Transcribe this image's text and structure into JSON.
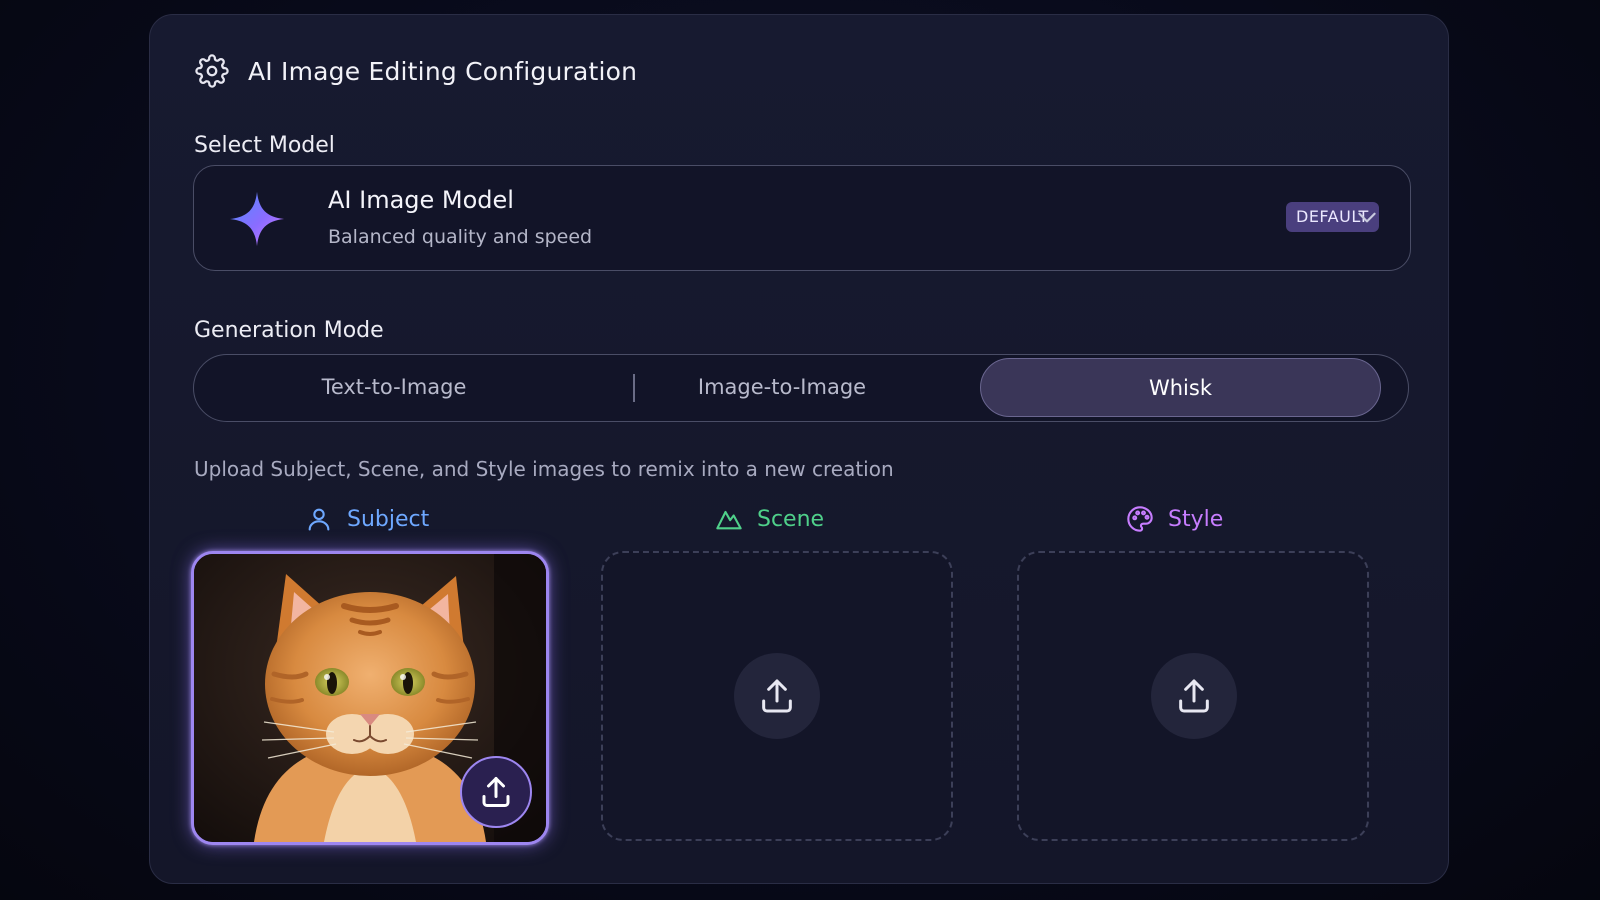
{
  "header": {
    "title": "AI Image Editing Configuration",
    "icon": "gear-icon"
  },
  "model": {
    "section_label": "Select Model",
    "name": "AI Image Model",
    "description": "Balanced quality and speed",
    "badge": "DEFAULT",
    "icon": "sparkle-star-icon"
  },
  "generation": {
    "section_label": "Generation Mode",
    "tabs": [
      {
        "label": "Text-to-Image",
        "active": false
      },
      {
        "label": "Image-to-Image",
        "active": false
      },
      {
        "label": "Whisk",
        "active": true
      }
    ],
    "hint": "Upload Subject, Scene, and Style images to remix into a new creation"
  },
  "slots": [
    {
      "label": "Subject",
      "icon": "person-icon",
      "color": "#6ea8ff",
      "filled": true,
      "image": "orange tabby cat photo"
    },
    {
      "label": "Scene",
      "icon": "mountain-icon",
      "color": "#4fd08a",
      "filled": false
    },
    {
      "label": "Style",
      "icon": "palette-icon",
      "color": "#c77dff",
      "filled": false
    }
  ],
  "colors": {
    "accent": "#9d86f0",
    "badge_bg": "#4a3f7e",
    "background": "#0b0d1e"
  }
}
